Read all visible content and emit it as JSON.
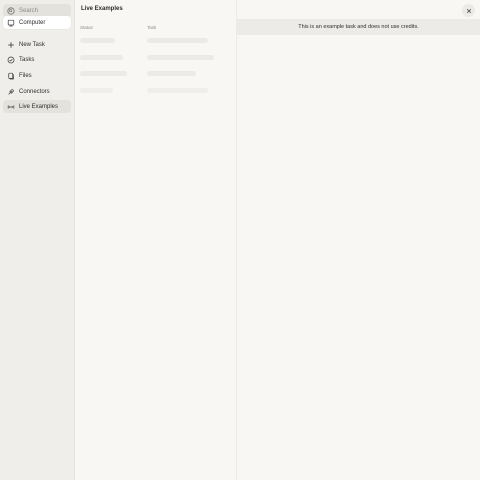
{
  "sidebar": {
    "search_label": "Search",
    "items": [
      {
        "label": "Computer",
        "icon": "computer-icon"
      },
      {
        "label": "New Task",
        "icon": "plus-icon"
      },
      {
        "label": "Tasks",
        "icon": "check-circle-icon"
      },
      {
        "label": "Files",
        "icon": "files-icon"
      },
      {
        "label": "Connectors",
        "icon": "connector-icon"
      },
      {
        "label": "Live Examples",
        "icon": "live-examples-icon"
      }
    ]
  },
  "list": {
    "title": "Live Examples",
    "columns": [
      "Status",
      "Task"
    ]
  },
  "detail": {
    "banner_text": "This is an example task and does not use credits."
  },
  "colors": {
    "sidebar_bg": "#efeeea",
    "page_bg": "#f8f7f4",
    "active_bg": "#e4e2dd",
    "banner_bg": "#ecebe7"
  }
}
